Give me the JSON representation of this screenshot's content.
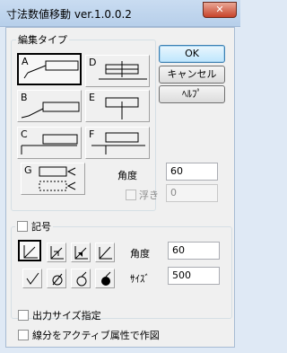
{
  "window": {
    "title": "寸法数値移動 ver.1.0.0.2",
    "close_glyph": "✕"
  },
  "layout_group": {
    "label": "編集タイプ",
    "selected": "A",
    "tiles": [
      "A",
      "B",
      "C",
      "D",
      "E",
      "F",
      "G"
    ],
    "angle_label": "角度",
    "angle_value": "60",
    "float_label": "浮き",
    "float_value": "0",
    "float_checked": false
  },
  "buttons": {
    "ok": "OK",
    "cancel": "キャンセル",
    "help": "ﾍﾙﾌﾟ"
  },
  "symbol_group": {
    "label": "記号",
    "checked": false,
    "angle_label": "角度",
    "angle_value": "60",
    "size_label": "ｻｲｽﾞ",
    "size_value": "500"
  },
  "options": {
    "output_size": "出力サイズ指定",
    "active_attr": "線分をアクティブ属性で作図"
  }
}
